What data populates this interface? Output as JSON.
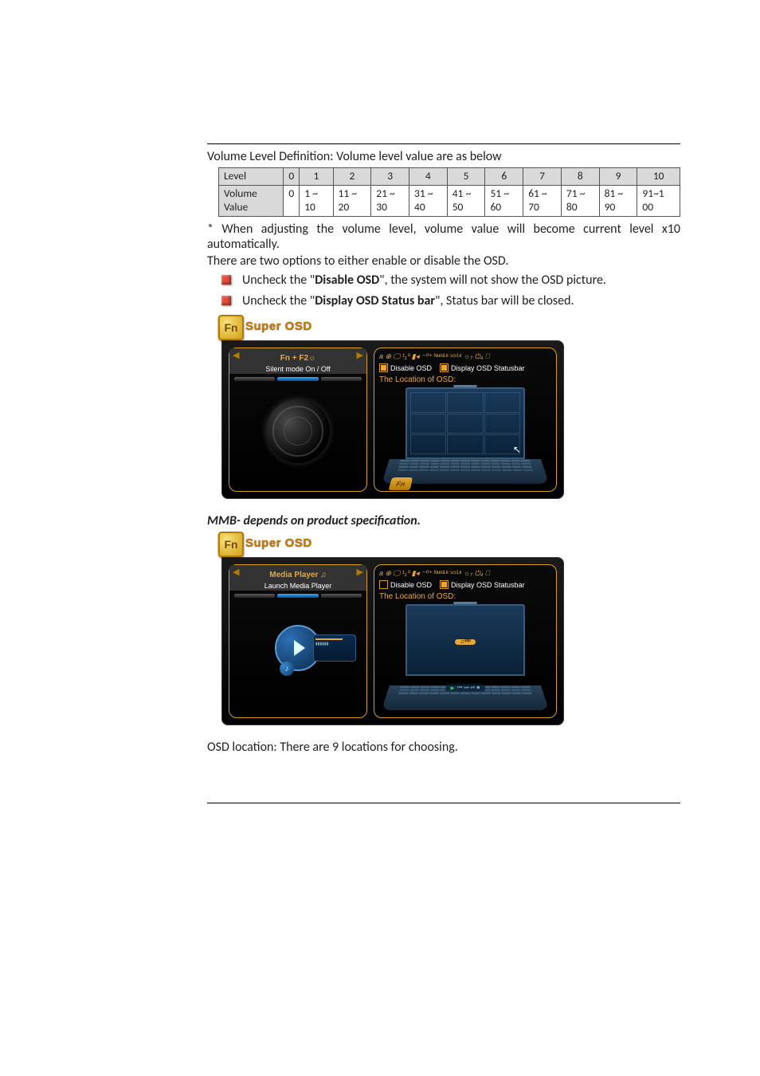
{
  "intro": "Volume Level Definition: Volume level value are as below",
  "table": {
    "row_label_level": "Level",
    "row_label_value": "Volume Value",
    "levels": [
      "0",
      "1",
      "2",
      "3",
      "4",
      "5",
      "6",
      "7",
      "8",
      "9",
      "10"
    ],
    "values": [
      "0",
      "1 ~ 10",
      "11 ~ 20",
      "21 ~ 30",
      "31 ~ 40",
      "41 ~ 50",
      "51 ~ 60",
      "61 ~ 70",
      "71 ~ 80",
      "81 ~ 90",
      "91~1 00"
    ]
  },
  "note1": "* When adjusting the volume level, volume value will become current level x10 automatically.",
  "options_intro": "There are two options to either enable or disable the OSD.",
  "opt1_a": "Uncheck the \"",
  "opt1_b": "Disable OSD",
  "opt1_c": "\", the system will not show the OSD picture.",
  "opt2_a": "Uncheck the \"",
  "opt2_b": "Display OSD Status bar",
  "opt2_c": "\", Status bar will be closed.",
  "osd_title": "Super OSD",
  "fn_key": "Fn",
  "sc1": {
    "tab_label": "Fn + F2",
    "tab_sub": "Silent mode On / Off",
    "chk1": "Disable OSD",
    "chk2": "Display OSD Statusbar",
    "loc_label": "The Location of OSD:",
    "icons_row": "a ⊕ 🖵 ¹₁⁰ ▮◂ ⁻⁰⁺ ᴺᵘᵐᴸᵏ ˢᶜʳᴸᵏ ☼₇ ⏻₄ ⎕"
  },
  "mmb": "MMB- depends on product specification.",
  "sc2": {
    "tab_label": "Media Player ♫",
    "tab_sub": "Launch Media Player",
    "chk1": "Disable OSD",
    "chk2": "Display OSD Statusbar",
    "loc_label": "The Location of OSD:",
    "status_gold": "♫ᴹᴹ",
    "media_icons": "⏮ ⏭ ⏯ ■"
  },
  "note2": "OSD location: There are 9 locations for choosing."
}
